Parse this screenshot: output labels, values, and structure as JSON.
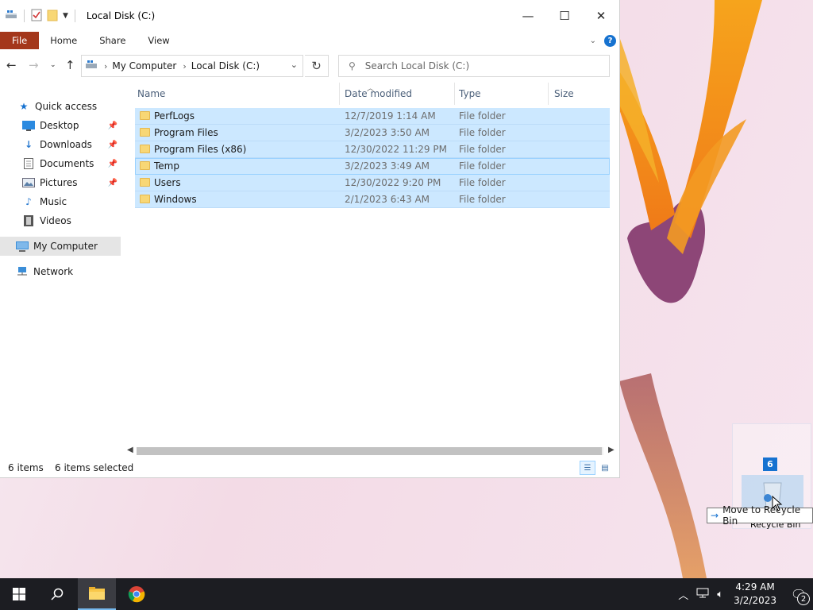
{
  "window": {
    "title": "Local Disk (C:)",
    "minimize_label": "—",
    "maximize_label": "☐",
    "close_label": "✕"
  },
  "ribbon": {
    "tabs": [
      "File",
      "Home",
      "Share",
      "View"
    ]
  },
  "address": {
    "crumbs": [
      "My Computer",
      "Local Disk (C:)"
    ],
    "search_placeholder": "Search Local Disk (C:)"
  },
  "nav": {
    "items": [
      {
        "label": "Quick access",
        "icon": "star-icon"
      },
      {
        "label": "Desktop",
        "icon": "desktop-icon",
        "pinned": true
      },
      {
        "label": "Downloads",
        "icon": "download-icon",
        "pinned": true
      },
      {
        "label": "Documents",
        "icon": "documents-icon",
        "pinned": true
      },
      {
        "label": "Pictures",
        "icon": "pictures-icon",
        "pinned": true
      },
      {
        "label": "Music",
        "icon": "music-icon"
      },
      {
        "label": "Videos",
        "icon": "videos-icon"
      },
      {
        "label": "My Computer",
        "icon": "computer-icon",
        "selected": true
      },
      {
        "label": "Network",
        "icon": "network-icon"
      }
    ]
  },
  "columns": {
    "name": "Name",
    "date": "Date modified",
    "type": "Type",
    "size": "Size"
  },
  "files": [
    {
      "name": "PerfLogs",
      "date": "12/7/2019 1:14 AM",
      "type": "File folder"
    },
    {
      "name": "Program Files",
      "date": "3/2/2023 3:50 AM",
      "type": "File folder"
    },
    {
      "name": "Program Files (x86)",
      "date": "12/30/2022 11:29 PM",
      "type": "File folder"
    },
    {
      "name": "Temp",
      "date": "3/2/2023 3:49 AM",
      "type": "File folder"
    },
    {
      "name": "Users",
      "date": "12/30/2022 9:20 PM",
      "type": "File folder"
    },
    {
      "name": "Windows",
      "date": "2/1/2023 6:43 AM",
      "type": "File folder"
    }
  ],
  "status": {
    "count": "6 items",
    "selected": "6 items selected"
  },
  "drag": {
    "count": "6",
    "tooltip": "Move to Recycle Bin",
    "target_label": "Recycle Bin"
  },
  "taskbar": {
    "time": "4:29 AM",
    "date": "3/2/2023",
    "notifications": "2"
  },
  "colors": {
    "accent": "#1672d0",
    "file_tab": "#a4371b",
    "selection": "#cce8ff",
    "taskbar": "#1c1d22"
  }
}
